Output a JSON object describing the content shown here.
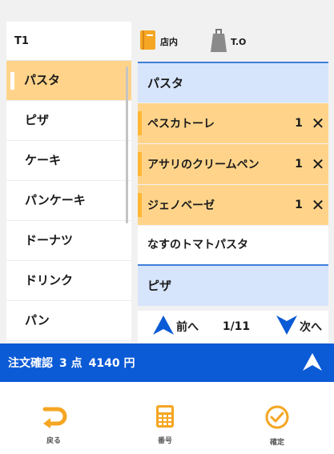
{
  "table": "T1",
  "header": {
    "store_label": "店内",
    "takeout_label": "T.O"
  },
  "categories": [
    "パスタ",
    "ピザ",
    "ケーキ",
    "パンケーキ",
    "ドーナツ",
    "ドリンク",
    "パン"
  ],
  "menu": {
    "section1": "パスタ",
    "ordered_items": [
      {
        "name": "ペスカトーレ",
        "qty": "1"
      },
      {
        "name": "アサリのクリームペン",
        "qty": "1"
      },
      {
        "name": "ジェノベーゼ",
        "qty": "1"
      }
    ],
    "plain_item": "なすのトマトパスタ",
    "section2": "ピザ"
  },
  "pager": {
    "prev": "前へ",
    "page": "1/11",
    "next": "次へ"
  },
  "confirm": {
    "label": "注文確認",
    "count": "3 点",
    "total": "4140 円"
  },
  "footer": {
    "back": "戻る",
    "number": "番号",
    "ok": "確定"
  },
  "colors": {
    "accent_blue": "#0b5ad6",
    "highlight": "#ffd48a",
    "section_bg": "#d6e5fb",
    "icon_orange": "#f5a623"
  }
}
